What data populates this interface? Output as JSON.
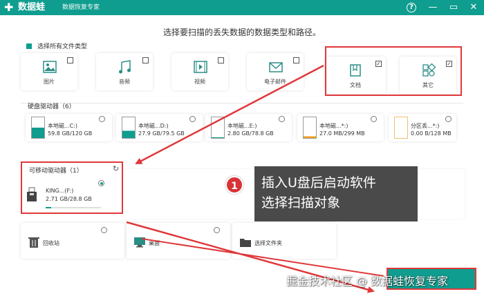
{
  "titlebar": {
    "logo_glyph": "✚",
    "app_name": "数据蛙",
    "subtitle": "数据恢复专家",
    "help": "?",
    "minimize": "—",
    "maximize": "▭",
    "close": "✕",
    "bg": "#0f9d8f"
  },
  "heading": "选择要扫描的丢失数据的数据类型和路径。",
  "select_all_label": "选择所有文件类型",
  "file_types": [
    {
      "label": "图片",
      "icon": "image-icon",
      "checked": false
    },
    {
      "label": "音频",
      "icon": "music-icon",
      "checked": false
    },
    {
      "label": "视频",
      "icon": "video-icon",
      "checked": false
    },
    {
      "label": "电子邮件",
      "icon": "email-icon",
      "checked": false
    },
    {
      "label": "文档",
      "icon": "document-icon",
      "checked": true
    },
    {
      "label": "其它",
      "icon": "other-icon",
      "checked": true
    }
  ],
  "hard_drives_label": "硬盘驱动器（6）",
  "hard_drives": [
    {
      "name": "本地磁...C:)",
      "size": "59.8 GB/120 GB",
      "fill": 0.5
    },
    {
      "name": "本地磁...D:)",
      "size": "27.9 GB/79.5 GB",
      "fill": 0.35
    },
    {
      "name": "本地磁...E:)",
      "size": "2.80 GB/78.8 GB",
      "fill": 0.04
    },
    {
      "name": "本地磁...*:)",
      "size": "27.0 MB/299 MB",
      "fill": 0.09
    },
    {
      "name": "分区丢...*:)",
      "size": "0.00  B/128 MB",
      "fill": 0.0
    }
  ],
  "removable_label": "可移动驱动器（1）",
  "removable_drive": {
    "name": "KING...(F:)",
    "size": "2.71 GB/28.8 GB",
    "fill": 0.094,
    "selected": true
  },
  "locations": [
    {
      "label": "回收站",
      "icon": "trash-icon"
    },
    {
      "label": "桌面",
      "icon": "desktop-icon"
    },
    {
      "label": "选择文件夹",
      "icon": "folder-icon"
    }
  ],
  "callout": {
    "number": "1",
    "line1": "插入U盘后启动软件",
    "line2": "选择扫描对象"
  },
  "watermark": "掘金技术社区 @ 数据蛙恢复专家",
  "colors": {
    "accent": "#0f9d8f",
    "highlight": "#e0373a"
  }
}
